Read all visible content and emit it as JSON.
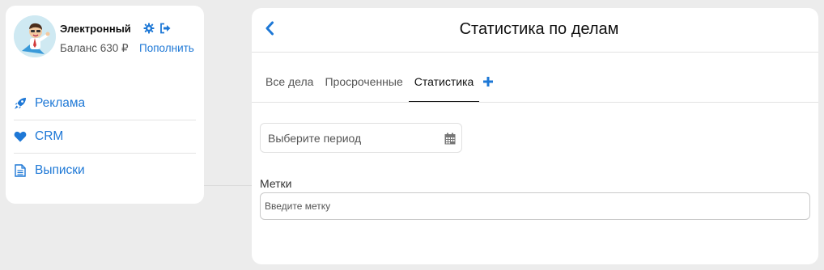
{
  "profile": {
    "name": "Электронный",
    "balance_text": "Баланс 630 ₽",
    "topup_label": "Пополнить"
  },
  "sidebar": {
    "items": [
      {
        "label": "Реклама",
        "icon": "rocket-icon"
      },
      {
        "label": "CRM",
        "icon": "heart-icon"
      },
      {
        "label": "Выписки",
        "icon": "document-icon"
      }
    ]
  },
  "main": {
    "title": "Статистика по делам",
    "tabs": [
      {
        "label": "Все дела",
        "active": false
      },
      {
        "label": "Просроченные",
        "active": false
      },
      {
        "label": "Статистика",
        "active": true
      }
    ],
    "period_placeholder": "Выберите период",
    "tags_label": "Метки",
    "tags_placeholder": "Введите метку"
  },
  "colors": {
    "accent": "#1e78d6",
    "background": "#ececec",
    "card": "#ffffff"
  }
}
